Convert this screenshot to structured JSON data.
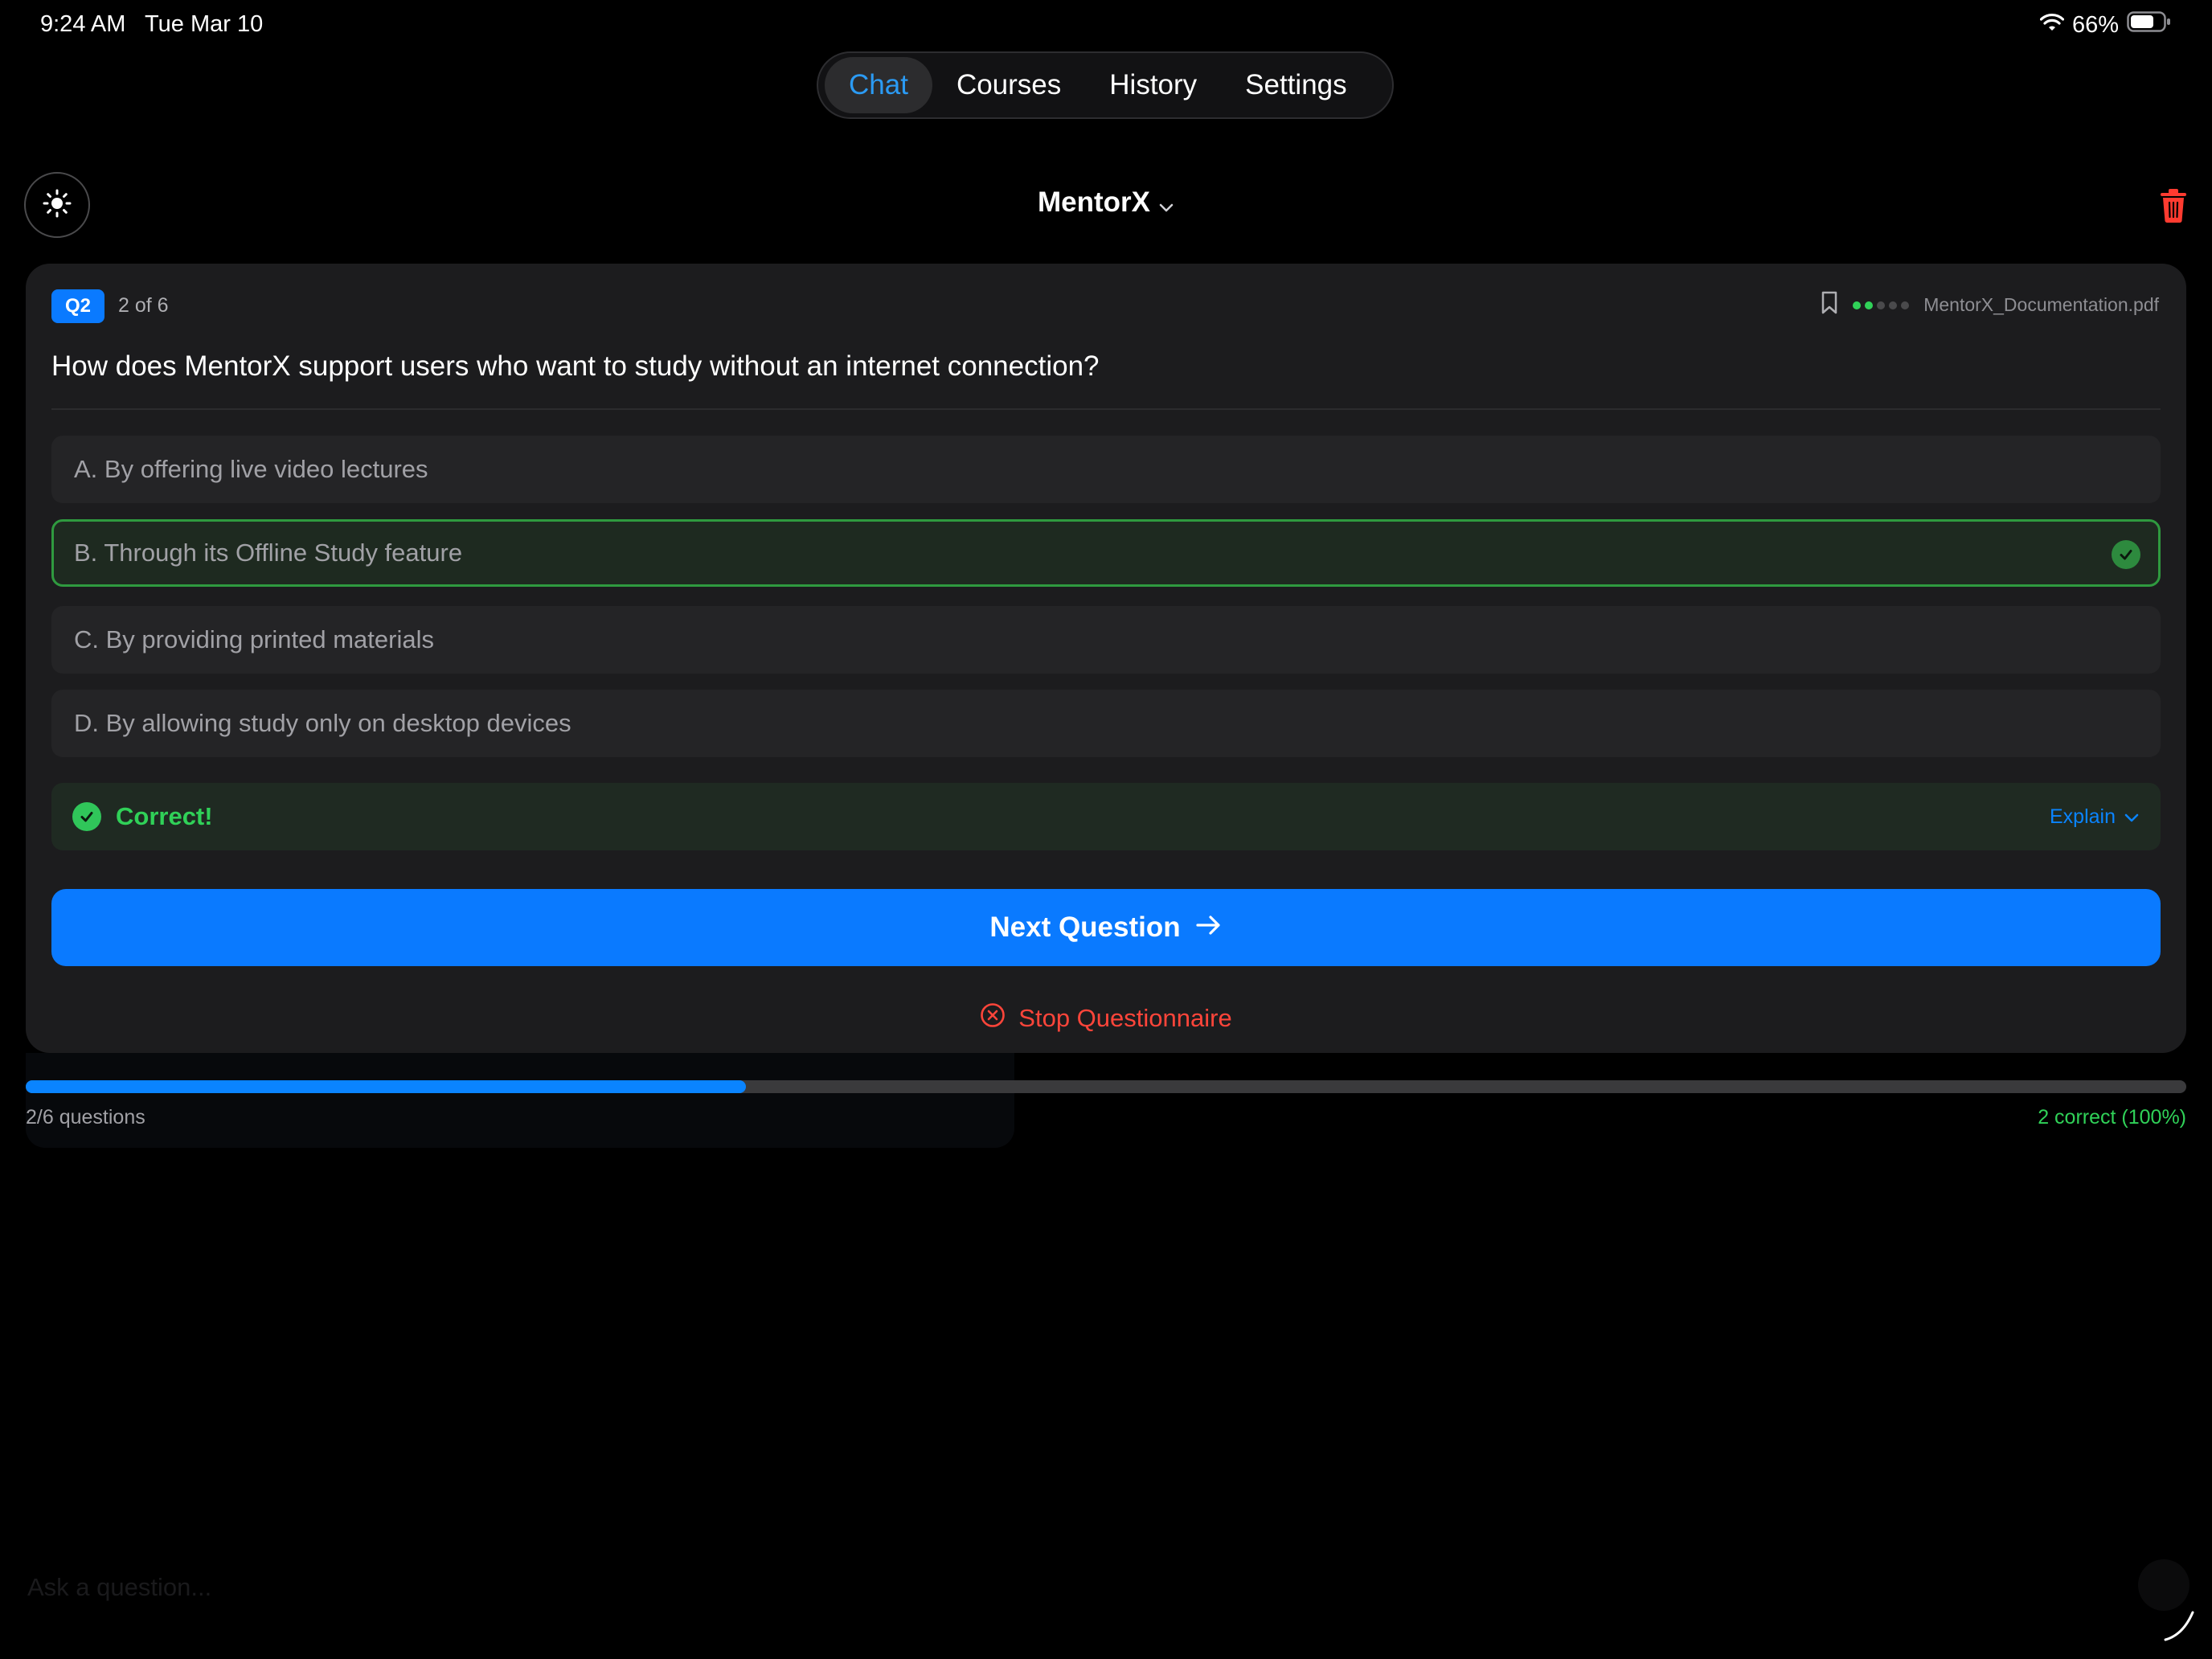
{
  "status_bar": {
    "time": "9:24 AM",
    "date": "Tue Mar 10",
    "battery": "66%"
  },
  "tabs": [
    {
      "label": "Chat",
      "active": true
    },
    {
      "label": "Courses",
      "active": false
    },
    {
      "label": "History",
      "active": false
    },
    {
      "label": "Settings",
      "active": false
    }
  ],
  "header": {
    "title": "MentorX"
  },
  "quiz": {
    "badge": "Q2",
    "counter": "2 of 6",
    "source_file": "MentorX_Documentation.pdf",
    "difficulty_dots": {
      "filled": 2,
      "total": 5
    },
    "question": "How does MentorX support users who want to study without an internet connection?",
    "options": [
      {
        "label": "A. By offering live video lectures",
        "correct": false
      },
      {
        "label": "B. Through its Offline Study feature",
        "correct": true
      },
      {
        "label": "C. By providing printed materials",
        "correct": false
      },
      {
        "label": "D. By allowing study only on desktop devices",
        "correct": false
      }
    ],
    "result_text": "Correct!",
    "explain_label": "Explain",
    "next_label": "Next Question",
    "stop_label": "Stop Questionnaire"
  },
  "progress": {
    "fraction": 0.3333,
    "label": "2/6 questions",
    "score": "2 correct (100%)"
  },
  "composer": {
    "placeholder": "Ask a question..."
  },
  "colors": {
    "accent": "#0a7aff",
    "correct": "#30d158",
    "danger": "#ff453a",
    "tab_active_text": "#2b9bf4"
  }
}
